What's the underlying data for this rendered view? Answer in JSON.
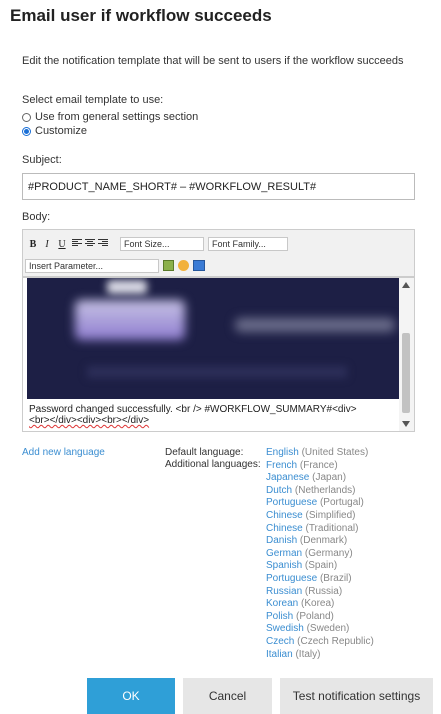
{
  "dialog": {
    "title": "Email user if workflow succeeds",
    "description": "Edit the notification template that will be sent to users if the workflow succeeds"
  },
  "template": {
    "label": "Select email template to use:",
    "options": [
      {
        "label": "Use from general settings section",
        "checked": false
      },
      {
        "label": "Customize",
        "checked": true
      }
    ]
  },
  "subject": {
    "label": "Subject:",
    "value": "#PRODUCT_NAME_SHORT# – #WORKFLOW_RESULT#"
  },
  "body": {
    "label": "Body:",
    "toolbar": {
      "bold": "B",
      "italic": "I",
      "underline": "U",
      "font_size": "Font Size...",
      "font_family": "Font Family...",
      "insert_parameter": "Insert Parameter..."
    },
    "content_line1": "Password changed successfully. <br /> #WORKFLOW_SUMMARY#<div>",
    "content_line2": "<br></div><div><br></div>"
  },
  "languages": {
    "add_link": "Add new language",
    "default_label": "Default language:",
    "additional_label": "Additional languages:",
    "list": [
      {
        "name": "English",
        "region": "(United States)"
      },
      {
        "name": "French",
        "region": "(France)"
      },
      {
        "name": "Japanese",
        "region": "(Japan)"
      },
      {
        "name": "Dutch",
        "region": "(Netherlands)"
      },
      {
        "name": "Portuguese",
        "region": "(Portugal)"
      },
      {
        "name": "Chinese",
        "region": "(Simplified)"
      },
      {
        "name": "Chinese",
        "region": "(Traditional)"
      },
      {
        "name": "Danish",
        "region": "(Denmark)"
      },
      {
        "name": "German",
        "region": "(Germany)"
      },
      {
        "name": "Spanish",
        "region": "(Spain)"
      },
      {
        "name": "Portuguese",
        "region": "(Brazil)"
      },
      {
        "name": "Russian",
        "region": "(Russia)"
      },
      {
        "name": "Korean",
        "region": "(Korea)"
      },
      {
        "name": "Polish",
        "region": "(Poland)"
      },
      {
        "name": "Swedish",
        "region": "(Sweden)"
      },
      {
        "name": "Czech",
        "region": "(Czech Republic)"
      },
      {
        "name": "Italian",
        "region": "(Italy)"
      }
    ]
  },
  "buttons": {
    "ok": "OK",
    "cancel": "Cancel",
    "test": "Test notification settings"
  },
  "colors": {
    "primary": "#2f9fd7",
    "link": "#3b8ed1",
    "banner": "#1d1f45"
  }
}
